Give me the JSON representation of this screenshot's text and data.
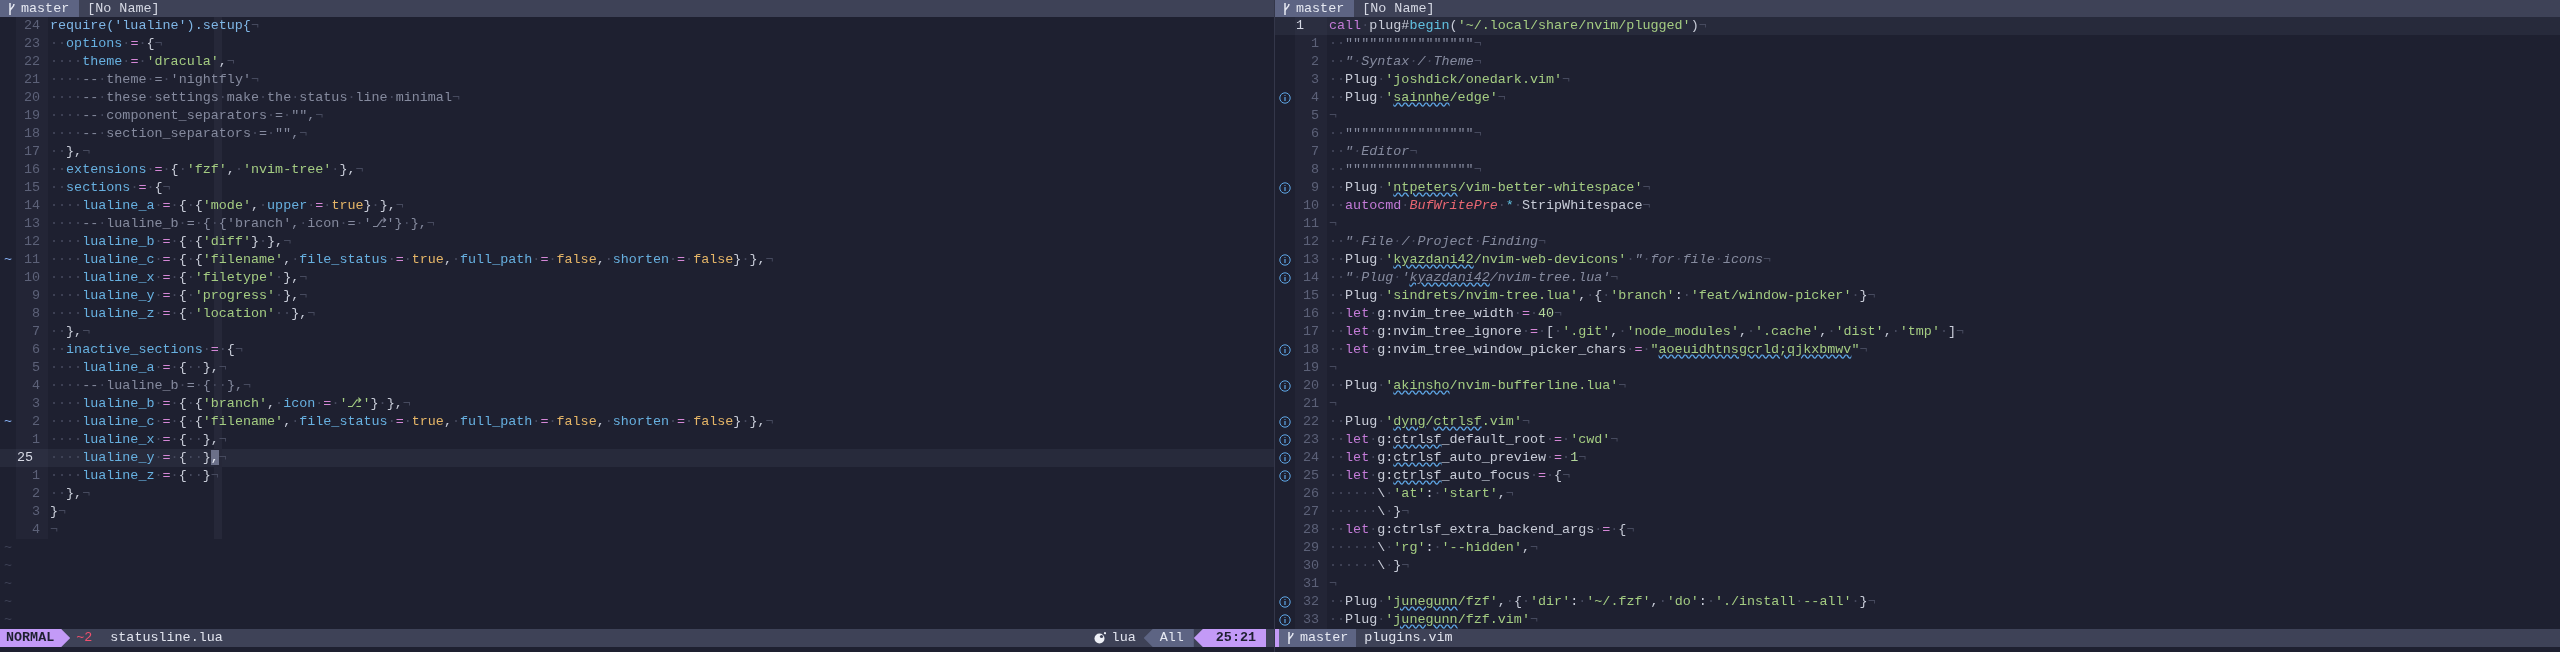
{
  "panes": [
    {
      "tabline": {
        "branch": "master",
        "buffer": "[No Name]"
      },
      "lines": [
        {
          "number": "24",
          "current": false,
          "tokens": [
            {
              "text": "require('lualine').setup{",
              "kind": "f"
            },
            {
              "text": "¬",
              "kind": "p"
            }
          ]
        },
        {
          "number": "23",
          "current": false,
          "tokens": [
            {
              "text": "··",
              "kind": "p"
            },
            {
              "text": "options",
              "kind": "k"
            },
            {
              "text": "·",
              "kind": "p"
            },
            {
              "text": "=",
              "kind": "o"
            },
            {
              "text": "·{¬",
              "kind": "p"
            }
          ]
        },
        {
          "number": "22",
          "current": false,
          "tokens": [
            {
              "text": "····",
              "kind": "p"
            },
            {
              "text": "theme",
              "kind": "k"
            },
            {
              "text": "·",
              "kind": "p"
            },
            {
              "text": "=",
              "kind": "o"
            },
            {
              "text": "·",
              "kind": "p"
            },
            {
              "text": "'dracula'",
              "kind": "s"
            },
            {
              "text": ",¬",
              "kind": "p"
            }
          ]
        },
        {
          "number": "21",
          "current": false,
          "tokens": [
            {
              "text": "····",
              "kind": "p"
            },
            {
              "text": "--·theme·=·'nightfly'¬",
              "kind": "c"
            }
          ]
        },
        {
          "number": "20",
          "current": false,
          "tokens": [
            {
              "text": "····",
              "kind": "p"
            },
            {
              "text": "--·these·settings·make·the·status·line·minimal¬",
              "kind": "c"
            }
          ]
        },
        {
          "number": "19",
          "current": false,
          "tokens": [
            {
              "text": "····",
              "kind": "p"
            },
            {
              "text": "--·component_separators·=·\"\",¬",
              "kind": "c"
            }
          ]
        },
        {
          "number": "18",
          "current": false,
          "tokens": [
            {
              "text": "····",
              "kind": "p"
            },
            {
              "text": "--·section_separators·=·\"\",¬",
              "kind": "c"
            }
          ]
        },
        {
          "number": "17",
          "current": false,
          "tokens": [
            {
              "text": "··},¬",
              "kind": "p"
            }
          ]
        },
        {
          "number": "16",
          "current": false,
          "tokens": [
            {
              "text": "··",
              "kind": "p"
            },
            {
              "text": "extensions",
              "kind": "k"
            },
            {
              "text": "·",
              "kind": "p"
            },
            {
              "text": "=",
              "kind": "o"
            },
            {
              "text": "·{·",
              "kind": "p"
            },
            {
              "text": "'fzf'",
              "kind": "s"
            },
            {
              "text": ",·",
              "kind": "p"
            },
            {
              "text": "'nvim-tree'",
              "kind": "s"
            },
            {
              "text": "·},¬",
              "kind": "p"
            }
          ]
        },
        {
          "number": "15",
          "current": false,
          "tokens": [
            {
              "text": "··",
              "kind": "p"
            },
            {
              "text": "sections",
              "kind": "k"
            },
            {
              "text": "·",
              "kind": "p"
            },
            {
              "text": "=",
              "kind": "o"
            },
            {
              "text": "·{¬",
              "kind": "p"
            }
          ]
        },
        {
          "number": "14",
          "current": false,
          "tokens": [
            {
              "text": "····",
              "kind": "p"
            },
            {
              "text": "lualine_a",
              "kind": "k"
            },
            {
              "text": "·",
              "kind": "p"
            },
            {
              "text": "=",
              "kind": "o"
            },
            {
              "text": "·{·{",
              "kind": "p"
            },
            {
              "text": "'mode'",
              "kind": "s"
            },
            {
              "text": ",·",
              "kind": "p"
            },
            {
              "text": "upper",
              "kind": "k"
            },
            {
              "text": "·",
              "kind": "p"
            },
            {
              "text": "=",
              "kind": "o"
            },
            {
              "text": "·",
              "kind": "p"
            },
            {
              "text": "true",
              "kind": "b"
            },
            {
              "text": "}·},¬",
              "kind": "p"
            }
          ]
        },
        {
          "number": "13",
          "current": false,
          "tokens": [
            {
              "text": "····",
              "kind": "p"
            },
            {
              "text": "--·lualine_b·=·{·{'branch',·icon·=·'⎇'}·},¬",
              "kind": "c"
            }
          ]
        },
        {
          "number": "12",
          "current": false,
          "tokens": [
            {
              "text": "····",
              "kind": "p"
            },
            {
              "text": "lualine_b",
              "kind": "k"
            },
            {
              "text": "·",
              "kind": "p"
            },
            {
              "text": "=",
              "kind": "o"
            },
            {
              "text": "·{·{",
              "kind": "p"
            },
            {
              "text": "'diff'",
              "kind": "s"
            },
            {
              "text": "}·},¬",
              "kind": "p"
            }
          ]
        },
        {
          "number": "11",
          "current": false,
          "sign": "~",
          "tokens": [
            {
              "text": "····",
              "kind": "p"
            },
            {
              "text": "lualine_c",
              "kind": "k"
            },
            {
              "text": "·",
              "kind": "p"
            },
            {
              "text": "=",
              "kind": "o"
            },
            {
              "text": "·{·{",
              "kind": "p"
            },
            {
              "text": "'filename'",
              "kind": "s"
            },
            {
              "text": ",·",
              "kind": "p"
            },
            {
              "text": "file_status",
              "kind": "k"
            },
            {
              "text": "·",
              "kind": "p"
            },
            {
              "text": "=",
              "kind": "o"
            },
            {
              "text": "·",
              "kind": "p"
            },
            {
              "text": "true",
              "kind": "b"
            },
            {
              "text": ",·",
              "kind": "p"
            },
            {
              "text": "full_path",
              "kind": "k"
            },
            {
              "text": "·",
              "kind": "p"
            },
            {
              "text": "=",
              "kind": "o"
            },
            {
              "text": "·",
              "kind": "p"
            },
            {
              "text": "false",
              "kind": "b"
            },
            {
              "text": ",·",
              "kind": "p"
            },
            {
              "text": "shorten",
              "kind": "k"
            },
            {
              "text": "·",
              "kind": "p"
            },
            {
              "text": "=",
              "kind": "o"
            },
            {
              "text": "·",
              "kind": "p"
            },
            {
              "text": "false",
              "kind": "b"
            },
            {
              "text": "}·},¬",
              "kind": "p"
            }
          ]
        },
        {
          "number": "10",
          "current": false,
          "tokens": [
            {
              "text": "····",
              "kind": "p"
            },
            {
              "text": "lualine_x",
              "kind": "k"
            },
            {
              "text": "·",
              "kind": "p"
            },
            {
              "text": "=",
              "kind": "o"
            },
            {
              "text": "·{·",
              "kind": "p"
            },
            {
              "text": "'filetype'",
              "kind": "s"
            },
            {
              "text": "·},¬",
              "kind": "p"
            }
          ]
        },
        {
          "number": "9",
          "current": false,
          "tokens": [
            {
              "text": "····",
              "kind": "p"
            },
            {
              "text": "lualine_y",
              "kind": "k"
            },
            {
              "text": "·",
              "kind": "p"
            },
            {
              "text": "=",
              "kind": "o"
            },
            {
              "text": "·{·",
              "kind": "p"
            },
            {
              "text": "'progress'",
              "kind": "s"
            },
            {
              "text": "·},¬",
              "kind": "p"
            }
          ]
        },
        {
          "number": "8",
          "current": false,
          "tokens": [
            {
              "text": "····",
              "kind": "p"
            },
            {
              "text": "lualine_z",
              "kind": "k"
            },
            {
              "text": "·",
              "kind": "p"
            },
            {
              "text": "=",
              "kind": "o"
            },
            {
              "text": "·{·",
              "kind": "p"
            },
            {
              "text": "'location'",
              "kind": "s"
            },
            {
              "text": "··},¬",
              "kind": "p"
            }
          ]
        },
        {
          "number": "7",
          "current": false,
          "tokens": [
            {
              "text": "··},¬",
              "kind": "p"
            }
          ]
        },
        {
          "number": "6",
          "current": false,
          "tokens": [
            {
              "text": "··",
              "kind": "p"
            },
            {
              "text": "inactive_sections",
              "kind": "k"
            },
            {
              "text": "·",
              "kind": "p"
            },
            {
              "text": "=",
              "kind": "o"
            },
            {
              "text": "·{¬",
              "kind": "p"
            }
          ]
        },
        {
          "number": "5",
          "current": false,
          "tokens": [
            {
              "text": "····",
              "kind": "p"
            },
            {
              "text": "lualine_a",
              "kind": "k"
            },
            {
              "text": "·",
              "kind": "p"
            },
            {
              "text": "=",
              "kind": "o"
            },
            {
              "text": "·{··},¬",
              "kind": "p"
            }
          ]
        },
        {
          "number": "4",
          "current": false,
          "tokens": [
            {
              "text": "····",
              "kind": "p"
            },
            {
              "text": "--·lualine_b·=·{··},¬",
              "kind": "c"
            }
          ]
        },
        {
          "number": "3",
          "current": false,
          "tokens": [
            {
              "text": "····",
              "kind": "p"
            },
            {
              "text": "lualine_b",
              "kind": "k"
            },
            {
              "text": "·",
              "kind": "p"
            },
            {
              "text": "=",
              "kind": "o"
            },
            {
              "text": "·{·{",
              "kind": "p"
            },
            {
              "text": "'branch'",
              "kind": "s"
            },
            {
              "text": ",·",
              "kind": "p"
            },
            {
              "text": "icon",
              "kind": "k"
            },
            {
              "text": "·",
              "kind": "p"
            },
            {
              "text": "=",
              "kind": "o"
            },
            {
              "text": "·",
              "kind": "p"
            },
            {
              "text": "'⎇'",
              "kind": "s"
            },
            {
              "text": "}·},¬",
              "kind": "p"
            }
          ]
        },
        {
          "number": "2",
          "current": false,
          "sign": "~",
          "tokens": [
            {
              "text": "····",
              "kind": "p"
            },
            {
              "text": "lualine_c",
              "kind": "k"
            },
            {
              "text": "·",
              "kind": "p"
            },
            {
              "text": "=",
              "kind": "o"
            },
            {
              "text": "·{·{",
              "kind": "p"
            },
            {
              "text": "'filename'",
              "kind": "s"
            },
            {
              "text": ",·",
              "kind": "p"
            },
            {
              "text": "file_status",
              "kind": "k"
            },
            {
              "text": "·",
              "kind": "p"
            },
            {
              "text": "=",
              "kind": "o"
            },
            {
              "text": "·",
              "kind": "p"
            },
            {
              "text": "true",
              "kind": "b"
            },
            {
              "text": ",·",
              "kind": "p"
            },
            {
              "text": "full_path",
              "kind": "k"
            },
            {
              "text": "·",
              "kind": "p"
            },
            {
              "text": "=",
              "kind": "o"
            },
            {
              "text": "·",
              "kind": "p"
            },
            {
              "text": "false",
              "kind": "b"
            },
            {
              "text": ",·",
              "kind": "p"
            },
            {
              "text": "shorten",
              "kind": "k"
            },
            {
              "text": "·",
              "kind": "p"
            },
            {
              "text": "=",
              "kind": "o"
            },
            {
              "text": "·",
              "kind": "p"
            },
            {
              "text": "false",
              "kind": "b"
            },
            {
              "text": "}·},¬",
              "kind": "p"
            }
          ]
        },
        {
          "number": "1",
          "current": false,
          "tokens": [
            {
              "text": "····",
              "kind": "p"
            },
            {
              "text": "lualine_x",
              "kind": "k"
            },
            {
              "text": "·",
              "kind": "p"
            },
            {
              "text": "=",
              "kind": "o"
            },
            {
              "text": "·{··},¬",
              "kind": "p"
            }
          ]
        },
        {
          "number": "25",
          "current": true,
          "tokens": [
            {
              "text": "····",
              "kind": "p"
            },
            {
              "text": "lualine_y",
              "kind": "k"
            },
            {
              "text": "·",
              "kind": "p"
            },
            {
              "text": "=",
              "kind": "o"
            },
            {
              "text": "·{··}",
              "kind": "p"
            },
            {
              "text": ",",
              "kind": "cur"
            },
            {
              "text": "¬",
              "kind": "p"
            }
          ]
        },
        {
          "number": "1",
          "current": false,
          "tokens": [
            {
              "text": "····",
              "kind": "p"
            },
            {
              "text": "lualine_z",
              "kind": "k"
            },
            {
              "text": "·",
              "kind": "p"
            },
            {
              "text": "=",
              "kind": "o"
            },
            {
              "text": "·{··}¬",
              "kind": "p"
            }
          ]
        },
        {
          "number": "2",
          "current": false,
          "tokens": [
            {
              "text": "··},¬",
              "kind": "p"
            }
          ]
        },
        {
          "number": "3",
          "current": false,
          "tokens": [
            {
              "text": "}¬",
              "kind": "p"
            }
          ]
        },
        {
          "number": "4",
          "current": false,
          "tokens": [
            {
              "text": "¬",
              "kind": "p"
            }
          ]
        }
      ],
      "filler": [
        "~",
        "~",
        "~",
        "~",
        "~"
      ],
      "statusline": {
        "mode": "NORMAL",
        "diff": "~2",
        "file": "statusline.lua",
        "filetype": "lua",
        "progress": "All",
        "location": "25:21"
      }
    },
    {
      "tabline": {
        "branch": "master",
        "buffer": "[No Name]"
      },
      "lines": [
        {
          "number": "1",
          "current": true,
          "info": false,
          "tokens": [
            {
              "text": "call",
              "kind": "kw"
            },
            {
              "text": "·plug#",
              "kind": "p"
            },
            {
              "text": "begin",
              "kind": "fn"
            },
            {
              "text": "(",
              "kind": "p"
            },
            {
              "text": "'~/.local/share/nvim/plugged'",
              "kind": "s"
            },
            {
              "text": ")¬",
              "kind": "p"
            }
          ]
        },
        {
          "number": "1",
          "current": false,
          "info": false,
          "tokens": [
            {
              "text": "··",
              "kind": "p"
            },
            {
              "text": "\"\"\"\"\"\"\"\"\"\"\"\"\"\"\"\"¬",
              "kind": "c"
            }
          ]
        },
        {
          "number": "2",
          "current": false,
          "info": false,
          "tokens": [
            {
              "text": "··",
              "kind": "p"
            },
            {
              "text": "\"·Syntax·/·Theme¬",
              "kind": "ci"
            }
          ]
        },
        {
          "number": "3",
          "current": false,
          "info": false,
          "tokens": [
            {
              "text": "··Plug·",
              "kind": "p"
            },
            {
              "text": "'joshdick/onedark.vim'",
              "kind": "s"
            },
            {
              "text": "¬",
              "kind": "p"
            }
          ]
        },
        {
          "number": "4",
          "current": false,
          "info": true,
          "tokens": [
            {
              "text": "··Plug·",
              "kind": "p"
            },
            {
              "text": "'",
              "kind": "s"
            },
            {
              "text": "sainnhe",
              "kind": "su"
            },
            {
              "text": "/edge'",
              "kind": "s"
            },
            {
              "text": "¬",
              "kind": "p"
            }
          ]
        },
        {
          "number": "5",
          "current": false,
          "info": false,
          "tokens": [
            {
              "text": "¬",
              "kind": "p"
            }
          ]
        },
        {
          "number": "6",
          "current": false,
          "info": false,
          "tokens": [
            {
              "text": "··",
              "kind": "p"
            },
            {
              "text": "\"\"\"\"\"\"\"\"\"\"\"\"\"\"\"\"¬",
              "kind": "c"
            }
          ]
        },
        {
          "number": "7",
          "current": false,
          "info": false,
          "tokens": [
            {
              "text": "··",
              "kind": "p"
            },
            {
              "text": "\"·Editor¬",
              "kind": "ci"
            }
          ]
        },
        {
          "number": "8",
          "current": false,
          "info": false,
          "tokens": [
            {
              "text": "··",
              "kind": "p"
            },
            {
              "text": "\"\"\"\"\"\"\"\"\"\"\"\"\"\"\"\"¬",
              "kind": "c"
            }
          ]
        },
        {
          "number": "9",
          "current": false,
          "info": true,
          "tokens": [
            {
              "text": "··Plug·",
              "kind": "p"
            },
            {
              "text": "'",
              "kind": "s"
            },
            {
              "text": "ntpeters",
              "kind": "su"
            },
            {
              "text": "/vim-better-whitespace'",
              "kind": "s"
            },
            {
              "text": "¬",
              "kind": "p"
            }
          ]
        },
        {
          "number": "10",
          "current": false,
          "info": false,
          "tokens": [
            {
              "text": "··",
              "kind": "p"
            },
            {
              "text": "autocmd",
              "kind": "kw"
            },
            {
              "text": "·",
              "kind": "p"
            },
            {
              "text": "BufWritePre",
              "kind": "t"
            },
            {
              "text": "·",
              "kind": "p"
            },
            {
              "text": "*",
              "kind": "fn"
            },
            {
              "text": "·StripWhitespace¬",
              "kind": "p"
            }
          ]
        },
        {
          "number": "11",
          "current": false,
          "info": false,
          "tokens": [
            {
              "text": "¬",
              "kind": "p"
            }
          ]
        },
        {
          "number": "12",
          "current": false,
          "info": false,
          "tokens": [
            {
              "text": "··",
              "kind": "p"
            },
            {
              "text": "\"·File·/·Project·Finding¬",
              "kind": "ci"
            }
          ]
        },
        {
          "number": "13",
          "current": false,
          "info": true,
          "tokens": [
            {
              "text": "··Plug·",
              "kind": "p"
            },
            {
              "text": "'",
              "kind": "s"
            },
            {
              "text": "kyazdani42",
              "kind": "su"
            },
            {
              "text": "/nvim-web-devicons'",
              "kind": "s"
            },
            {
              "text": "·",
              "kind": "p"
            },
            {
              "text": "\"·for·file·icons¬",
              "kind": "ci"
            }
          ]
        },
        {
          "number": "14",
          "current": false,
          "info": true,
          "tokens": [
            {
              "text": "··",
              "kind": "p"
            },
            {
              "text": "\"·Plug·'",
              "kind": "ci"
            },
            {
              "text": "kyazdani42",
              "kind": "cu"
            },
            {
              "text": "/nvim-tree.lua'¬",
              "kind": "ci"
            }
          ]
        },
        {
          "number": "15",
          "current": false,
          "info": false,
          "tokens": [
            {
              "text": "··Plug·",
              "kind": "p"
            },
            {
              "text": "'sindrets/nvim-tree.lua'",
              "kind": "s"
            },
            {
              "text": ",·{·",
              "kind": "p"
            },
            {
              "text": "'branch'",
              "kind": "s"
            },
            {
              "text": ":·",
              "kind": "p"
            },
            {
              "text": "'feat/window-picker'",
              "kind": "s"
            },
            {
              "text": "·}¬",
              "kind": "p"
            }
          ]
        },
        {
          "number": "16",
          "current": false,
          "info": false,
          "tokens": [
            {
              "text": "··",
              "kind": "p"
            },
            {
              "text": "let",
              "kind": "kw"
            },
            {
              "text": "·g:nvim_tree_width·",
              "kind": "p"
            },
            {
              "text": "=",
              "kind": "o"
            },
            {
              "text": "·",
              "kind": "p"
            },
            {
              "text": "40",
              "kind": "n"
            },
            {
              "text": "¬",
              "kind": "p"
            }
          ]
        },
        {
          "number": "17",
          "current": false,
          "info": false,
          "tokens": [
            {
              "text": "··",
              "kind": "p"
            },
            {
              "text": "let",
              "kind": "kw"
            },
            {
              "text": "·g:nvim_tree_ignore·",
              "kind": "p"
            },
            {
              "text": "=",
              "kind": "o"
            },
            {
              "text": "·[·",
              "kind": "p"
            },
            {
              "text": "'.git'",
              "kind": "s"
            },
            {
              "text": ",·",
              "kind": "p"
            },
            {
              "text": "'node_modules'",
              "kind": "s"
            },
            {
              "text": ",·",
              "kind": "p"
            },
            {
              "text": "'.cache'",
              "kind": "s"
            },
            {
              "text": ",·",
              "kind": "p"
            },
            {
              "text": "'dist'",
              "kind": "s"
            },
            {
              "text": ",·",
              "kind": "p"
            },
            {
              "text": "'tmp'",
              "kind": "s"
            },
            {
              "text": "·]¬",
              "kind": "p"
            }
          ]
        },
        {
          "number": "18",
          "current": false,
          "info": true,
          "tokens": [
            {
              "text": "··",
              "kind": "p"
            },
            {
              "text": "let",
              "kind": "kw"
            },
            {
              "text": "·g:nvim_tree_window_picker_chars·",
              "kind": "p"
            },
            {
              "text": "=",
              "kind": "o"
            },
            {
              "text": "·",
              "kind": "p"
            },
            {
              "text": "\"",
              "kind": "s"
            },
            {
              "text": "aoeuidhtnsgcrld;qjkxbmwv",
              "kind": "su"
            },
            {
              "text": "\"",
              "kind": "s"
            },
            {
              "text": "¬",
              "kind": "p"
            }
          ]
        },
        {
          "number": "19",
          "current": false,
          "info": false,
          "tokens": [
            {
              "text": "¬",
              "kind": "p"
            }
          ]
        },
        {
          "number": "20",
          "current": false,
          "info": true,
          "tokens": [
            {
              "text": "··Plug·",
              "kind": "p"
            },
            {
              "text": "'",
              "kind": "s"
            },
            {
              "text": "akinsho",
              "kind": "su"
            },
            {
              "text": "/nvim-bufferline.lua'",
              "kind": "s"
            },
            {
              "text": "¬",
              "kind": "p"
            }
          ]
        },
        {
          "number": "21",
          "current": false,
          "info": false,
          "tokens": [
            {
              "text": "¬",
              "kind": "p"
            }
          ]
        },
        {
          "number": "22",
          "current": false,
          "info": true,
          "tokens": [
            {
              "text": "··Plug·",
              "kind": "p"
            },
            {
              "text": "'",
              "kind": "s"
            },
            {
              "text": "dyng",
              "kind": "su"
            },
            {
              "text": "/",
              "kind": "s"
            },
            {
              "text": "ctrlsf",
              "kind": "su"
            },
            {
              "text": ".vim'",
              "kind": "s"
            },
            {
              "text": "¬",
              "kind": "p"
            }
          ]
        },
        {
          "number": "23",
          "current": false,
          "info": true,
          "tokens": [
            {
              "text": "··",
              "kind": "p"
            },
            {
              "text": "let",
              "kind": "kw"
            },
            {
              "text": "·g:",
              "kind": "p"
            },
            {
              "text": "ctrlsf",
              "kind": "pu"
            },
            {
              "text": "_default_root·",
              "kind": "p"
            },
            {
              "text": "=",
              "kind": "o"
            },
            {
              "text": "·",
              "kind": "p"
            },
            {
              "text": "'cwd'",
              "kind": "s"
            },
            {
              "text": "¬",
              "kind": "p"
            }
          ]
        },
        {
          "number": "24",
          "current": false,
          "info": true,
          "tokens": [
            {
              "text": "··",
              "kind": "p"
            },
            {
              "text": "let",
              "kind": "kw"
            },
            {
              "text": "·g:",
              "kind": "p"
            },
            {
              "text": "ctrlsf",
              "kind": "pu"
            },
            {
              "text": "_auto_preview·",
              "kind": "p"
            },
            {
              "text": "=",
              "kind": "o"
            },
            {
              "text": "·",
              "kind": "p"
            },
            {
              "text": "1",
              "kind": "n"
            },
            {
              "text": "¬",
              "kind": "p"
            }
          ]
        },
        {
          "number": "25",
          "current": false,
          "info": true,
          "tokens": [
            {
              "text": "··",
              "kind": "p"
            },
            {
              "text": "let",
              "kind": "kw"
            },
            {
              "text": "·g:",
              "kind": "p"
            },
            {
              "text": "ctrlsf",
              "kind": "pu"
            },
            {
              "text": "_auto_focus·",
              "kind": "p"
            },
            {
              "text": "=",
              "kind": "o"
            },
            {
              "text": "·{¬",
              "kind": "p"
            }
          ]
        },
        {
          "number": "26",
          "current": false,
          "info": false,
          "tokens": [
            {
              "text": "······\\·",
              "kind": "p"
            },
            {
              "text": "'at'",
              "kind": "s"
            },
            {
              "text": ":·",
              "kind": "p"
            },
            {
              "text": "'start'",
              "kind": "s"
            },
            {
              "text": ",¬",
              "kind": "p"
            }
          ]
        },
        {
          "number": "27",
          "current": false,
          "info": false,
          "tokens": [
            {
              "text": "······\\·}¬",
              "kind": "p"
            }
          ]
        },
        {
          "number": "28",
          "current": false,
          "info": false,
          "tokens": [
            {
              "text": "··",
              "kind": "p"
            },
            {
              "text": "let",
              "kind": "kw"
            },
            {
              "text": "·g:ctrlsf_extra_backend_args·",
              "kind": "p"
            },
            {
              "text": "=",
              "kind": "o"
            },
            {
              "text": "·{¬",
              "kind": "p"
            }
          ]
        },
        {
          "number": "29",
          "current": false,
          "info": false,
          "tokens": [
            {
              "text": "······\\·",
              "kind": "p"
            },
            {
              "text": "'rg'",
              "kind": "s"
            },
            {
              "text": ":·",
              "kind": "p"
            },
            {
              "text": "'--hidden'",
              "kind": "s"
            },
            {
              "text": ",¬",
              "kind": "p"
            }
          ]
        },
        {
          "number": "30",
          "current": false,
          "info": false,
          "tokens": [
            {
              "text": "······\\·}¬",
              "kind": "p"
            }
          ]
        },
        {
          "number": "31",
          "current": false,
          "info": false,
          "tokens": [
            {
              "text": "¬",
              "kind": "p"
            }
          ]
        },
        {
          "number": "32",
          "current": false,
          "info": true,
          "tokens": [
            {
              "text": "··Plug·",
              "kind": "p"
            },
            {
              "text": "'",
              "kind": "s"
            },
            {
              "text": "junegunn",
              "kind": "su"
            },
            {
              "text": "/fzf'",
              "kind": "s"
            },
            {
              "text": ",·{·",
              "kind": "p"
            },
            {
              "text": "'dir'",
              "kind": "s"
            },
            {
              "text": ":·",
              "kind": "p"
            },
            {
              "text": "'~/.fzf'",
              "kind": "s"
            },
            {
              "text": ",·",
              "kind": "p"
            },
            {
              "text": "'do'",
              "kind": "s"
            },
            {
              "text": ":·",
              "kind": "p"
            },
            {
              "text": "'./install·--all'",
              "kind": "s"
            },
            {
              "text": "·}¬",
              "kind": "p"
            }
          ]
        },
        {
          "number": "33",
          "current": false,
          "info": true,
          "tokens": [
            {
              "text": "··Plug·",
              "kind": "p"
            },
            {
              "text": "'",
              "kind": "s"
            },
            {
              "text": "junegunn",
              "kind": "su"
            },
            {
              "text": "/fzf.vim'",
              "kind": "s"
            },
            {
              "text": "¬",
              "kind": "p"
            }
          ]
        }
      ],
      "statusline": {
        "branch": "master",
        "file": "plugins.vim"
      }
    }
  ]
}
